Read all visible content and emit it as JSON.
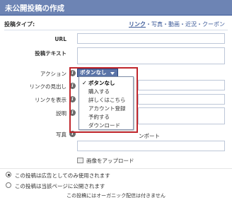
{
  "dialog": {
    "title": "未公開投稿の作成"
  },
  "post_type": {
    "label": "投稿タイプ:",
    "options": [
      {
        "label": "リンク",
        "active": true
      },
      {
        "label": "写真",
        "active": false
      },
      {
        "label": "動画",
        "active": false
      },
      {
        "label": "近況",
        "active": false
      },
      {
        "label": "クーポン",
        "active": false
      }
    ],
    "separator": "・"
  },
  "form": {
    "url_label": "URL",
    "post_text_label": "投稿テキスト",
    "action_label": "アクション",
    "link_headline_label": "リンクの見出し",
    "link_display_label": "リンクを表示",
    "description_label": "説明",
    "photo_label": "写真",
    "photo_note_tail": "ンポート",
    "upload_label": "画像をアップロード",
    "info_icon_glyph": "i"
  },
  "action_dropdown": {
    "selected_label": "ボタンなし",
    "items": [
      {
        "label": "ボタンなし",
        "selected": true
      },
      {
        "label": "購入する",
        "selected": false
      },
      {
        "label": "詳しくはこちら",
        "selected": false
      },
      {
        "label": "アカウント登録",
        "selected": false
      },
      {
        "label": "予約する",
        "selected": false
      },
      {
        "label": "ダウンロード",
        "selected": false
      }
    ],
    "check_glyph": "✓"
  },
  "publishing": {
    "options": [
      {
        "label": "この投稿は広告としてのみ使用されます",
        "selected": true
      },
      {
        "label": "この投稿は当該ページに公開されます",
        "selected": false
      }
    ],
    "note": "この投稿にはオーガニック配信は付きません"
  },
  "colors": {
    "header_bg": "#6d84b4",
    "link": "#3b5998",
    "button_bg": "#5b74a8",
    "highlight": "#c0262c"
  }
}
